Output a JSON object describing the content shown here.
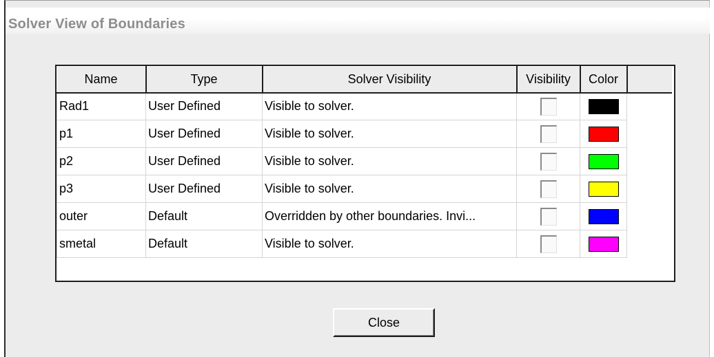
{
  "window": {
    "title": "Solver View of Boundaries"
  },
  "table": {
    "columns": [
      "Name",
      "Type",
      "Solver Visibility",
      "Visibility",
      "Color"
    ],
    "rows": [
      {
        "name": "Rad1",
        "type": "User Defined",
        "solver_visibility": "Visible to solver.",
        "visible": false,
        "color": "#000000"
      },
      {
        "name": "p1",
        "type": "User Defined",
        "solver_visibility": "Visible to solver.",
        "visible": false,
        "color": "#ff0000"
      },
      {
        "name": "p2",
        "type": "User Defined",
        "solver_visibility": "Visible to solver.",
        "visible": false,
        "color": "#00ff00"
      },
      {
        "name": "p3",
        "type": "User Defined",
        "solver_visibility": "Visible to solver.",
        "visible": false,
        "color": "#ffff00"
      },
      {
        "name": "outer",
        "type": "Default",
        "solver_visibility": "Overridden by other boundaries. Invi...",
        "visible": false,
        "color": "#0000ff"
      },
      {
        "name": "smetal",
        "type": "Default",
        "solver_visibility": "Visible to solver.",
        "visible": false,
        "color": "#ff00ff"
      }
    ]
  },
  "buttons": {
    "close": "Close"
  }
}
